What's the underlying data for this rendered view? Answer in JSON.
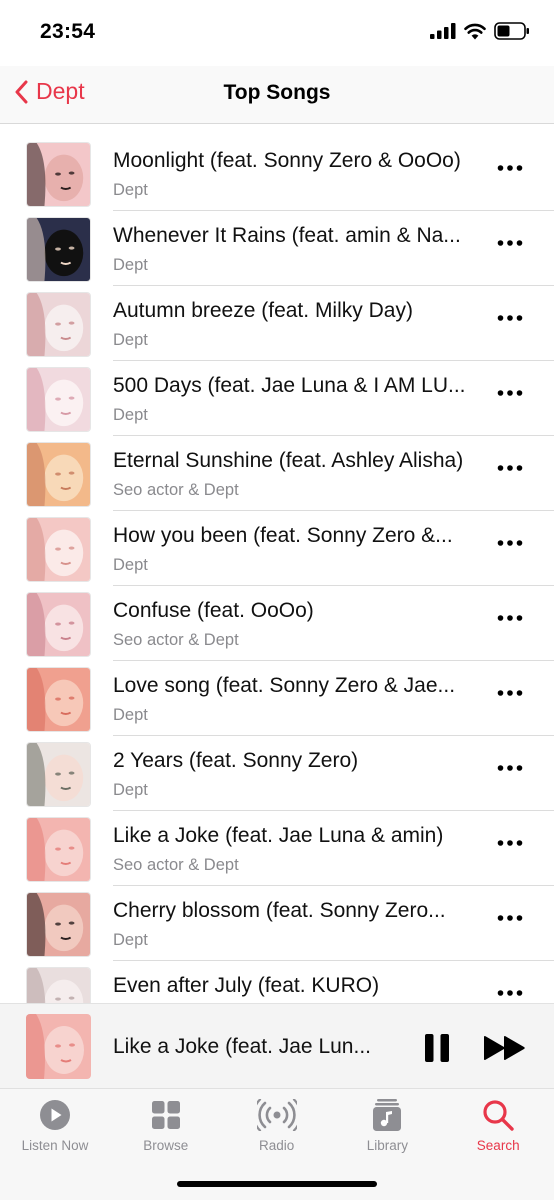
{
  "status_bar": {
    "time": "23:54"
  },
  "nav": {
    "back_label": "Dept",
    "title": "Top Songs"
  },
  "colors": {
    "accent": "#e8374a",
    "secondary_text": "#8a8a8e"
  },
  "songs": [
    {
      "title": "Moonlight (feat. Sonny Zero & OoOo)",
      "artist": "Dept",
      "art": [
        "#f3c7c9",
        "#2b1d1d",
        "#e7b0ad"
      ]
    },
    {
      "title": "Whenever It Rains (feat. amin & Na...",
      "artist": "Dept",
      "art": [
        "#2b2f4a",
        "#f1d9c8",
        "#111"
      ]
    },
    {
      "title": "Autumn breeze (feat. Milky Day)",
      "artist": "Dept",
      "art": [
        "#ecd6d8",
        "#c98b8d",
        "#f6eeee"
      ]
    },
    {
      "title": "500 Days (feat. Jae Luna & I AM LU...",
      "artist": "Dept",
      "art": [
        "#f1dadf",
        "#d79aa6",
        "#fbf1f2"
      ]
    },
    {
      "title": "Eternal Sunshine (feat. Ashley Alisha)",
      "artist": "Seo actor & Dept",
      "art": [
        "#f3b98a",
        "#c77b5c",
        "#f8d9b8"
      ]
    },
    {
      "title": "How you been (feat. Sonny Zero &...",
      "artist": "Dept",
      "art": [
        "#f4c8c5",
        "#d7918b",
        "#fbeae8"
      ]
    },
    {
      "title": "Confuse (feat. OoOo)",
      "artist": "Seo actor & Dept",
      "art": [
        "#efc1c5",
        "#c9818c",
        "#f8e2e3"
      ]
    },
    {
      "title": "Love song (feat. Sonny Zero & Jae...",
      "artist": "Dept",
      "art": [
        "#f0a08f",
        "#d86c5d",
        "#f7c8b8"
      ]
    },
    {
      "title": "2 Years (feat. Sonny Zero)",
      "artist": "Dept",
      "art": [
        "#ece5e2",
        "#6b6e63",
        "#f4ddd5"
      ]
    },
    {
      "title": "Like a Joke (feat. Jae Luna & amin)",
      "artist": "Seo actor & Dept",
      "art": [
        "#f3b5b0",
        "#e47d78",
        "#f7d3cf"
      ]
    },
    {
      "title": "Cherry blossom (feat. Sonny Zero...",
      "artist": "Dept",
      "art": [
        "#e7a9a0",
        "#2a1f1f",
        "#f1c9bf"
      ]
    },
    {
      "title": "Even after July (feat. KURO)",
      "artist": "",
      "art": [
        "#e9dede",
        "#b7a3a3",
        "#f5eded"
      ]
    }
  ],
  "now_playing": {
    "title": "Like a Joke (feat. Jae Lun...",
    "art": [
      "#f3b5b0",
      "#e47d78",
      "#f7d3cf"
    ]
  },
  "tabs": [
    {
      "label": "Listen Now",
      "icon": "play-circle-icon",
      "active": false
    },
    {
      "label": "Browse",
      "icon": "grid-icon",
      "active": false
    },
    {
      "label": "Radio",
      "icon": "radio-waves-icon",
      "active": false
    },
    {
      "label": "Library",
      "icon": "library-icon",
      "active": false
    },
    {
      "label": "Search",
      "icon": "search-icon",
      "active": true
    }
  ]
}
